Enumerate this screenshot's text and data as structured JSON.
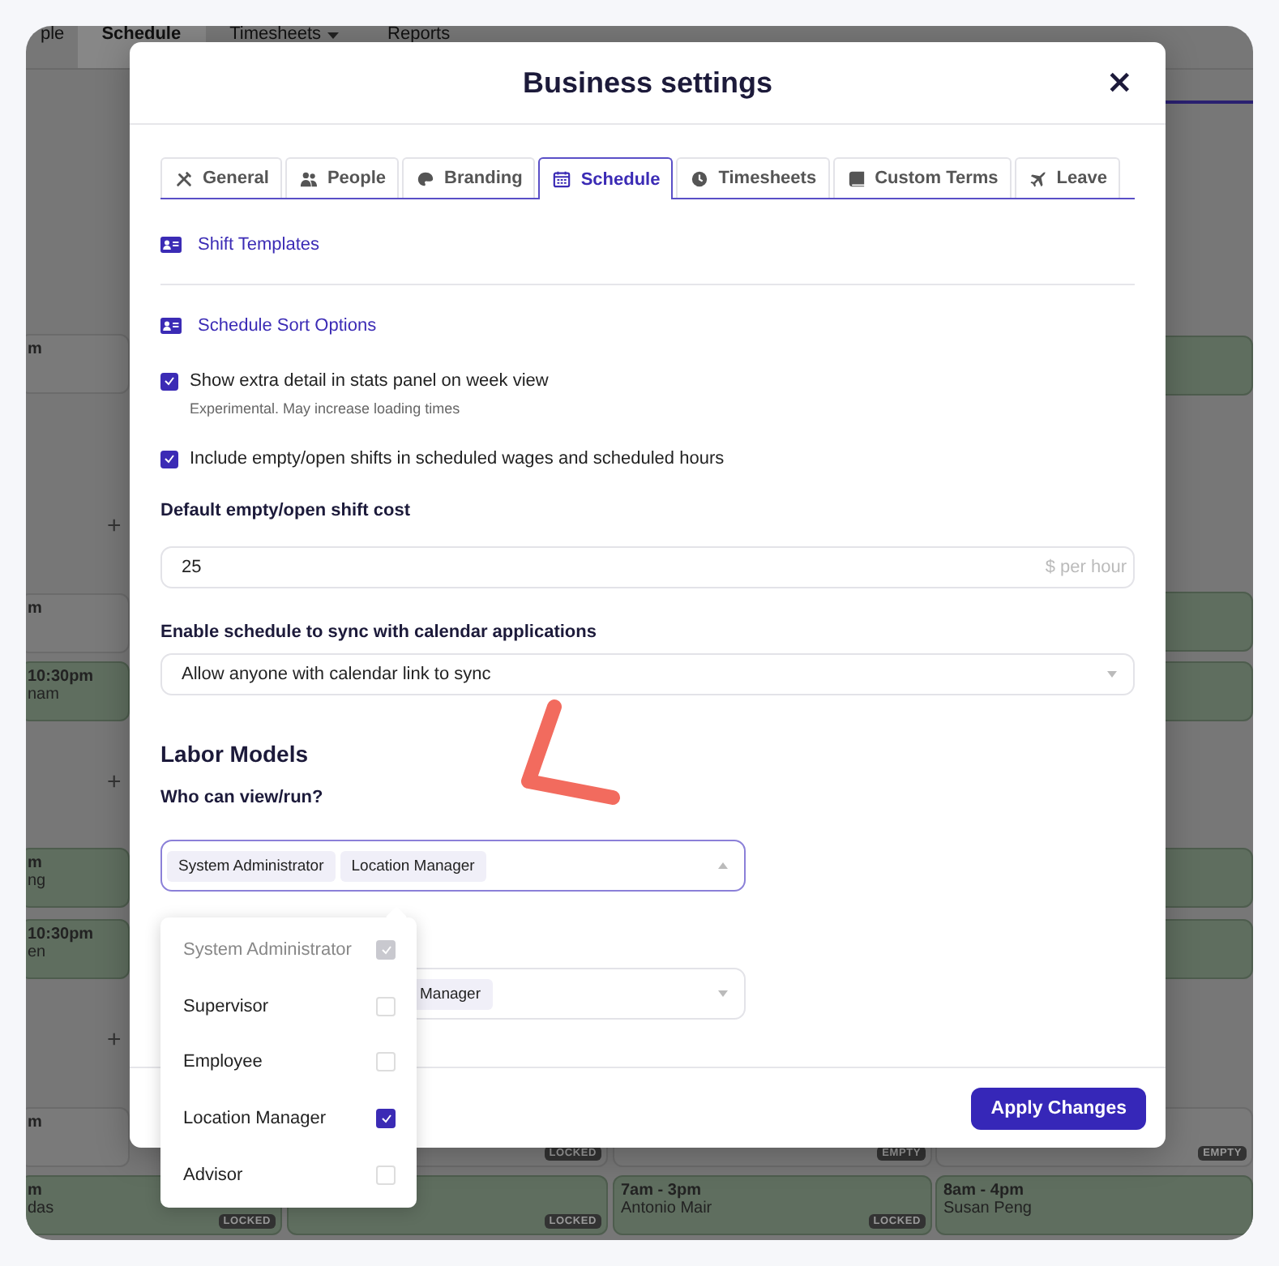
{
  "background": {
    "nav": [
      {
        "label": "ple",
        "selected": false,
        "dropdown": false
      },
      {
        "label": "Schedule",
        "selected": true,
        "dropdown": false
      },
      {
        "label": "Timesheets",
        "selected": false,
        "dropdown": true
      },
      {
        "label": "Reports",
        "selected": false,
        "dropdown": false
      }
    ],
    "shifts": [
      {
        "time": "m",
        "filled": false
      },
      {
        "time": "m",
        "filled": false
      },
      {
        "time": "10:30pm",
        "name": "nam",
        "filled": true
      },
      {
        "time": "m",
        "name": "ng",
        "filled": true
      },
      {
        "time": "10:30pm",
        "name": "en",
        "filled": true
      },
      {
        "time": "m",
        "filled": false
      },
      {
        "time": "m",
        "name": "das",
        "badge": "LOCKED",
        "filled": true
      },
      {
        "badge": "LOCKED",
        "filled": false
      },
      {
        "badge": "LOCKED",
        "filled": true
      },
      {
        "badge": "EMPTY",
        "filled": false
      },
      {
        "time": "7am - 3pm",
        "name": "Antonio Mair",
        "badge": "LOCKED",
        "filled": true
      },
      {
        "badge": "EMPTY",
        "filled": false
      },
      {
        "time": "8am - 4pm",
        "name": "Susan Peng",
        "filled": true
      },
      {
        "filled": true
      },
      {
        "filled": true
      },
      {
        "filled": true
      },
      {
        "filled": true
      },
      {
        "filled": true
      }
    ],
    "add_buttons": [
      "+",
      "+",
      "+"
    ]
  },
  "dialog": {
    "title": "Business settings",
    "close": "×",
    "tabs": [
      {
        "label": "General",
        "selected": false
      },
      {
        "label": "People",
        "selected": false
      },
      {
        "label": "Branding",
        "selected": false
      },
      {
        "label": "Schedule",
        "selected": true
      },
      {
        "label": "Timesheets",
        "selected": false
      },
      {
        "label": "Custom Terms",
        "selected": false
      },
      {
        "label": "Leave",
        "selected": false
      }
    ],
    "links": [
      "Shift Templates",
      "Schedule Sort Options"
    ],
    "options": [
      {
        "label": "Show extra detail in stats panel on week view",
        "hint": "Experimental. May increase loading times",
        "checked": true
      },
      {
        "label": "Include empty/open shifts in scheduled wages and scheduled hours",
        "checked": true
      }
    ],
    "cost": {
      "label": "Default empty/open shift cost",
      "value": "25",
      "suffix": "$ per hour"
    },
    "calendar_sync": {
      "label": "Enable schedule to sync with calendar applications",
      "value": "Allow anyone with calendar link to sync"
    },
    "labor_models": {
      "heading": "Labor Models",
      "view_label": "Who can view/run?",
      "view_select": {
        "tags": [
          "System Administrator",
          "Location Manager"
        ],
        "open": true
      },
      "run_select": {
        "tags": [
          "Manager"
        ],
        "open": false
      },
      "menu": [
        {
          "label": "System Administrator",
          "checked": true,
          "disabled": true
        },
        {
          "label": "Supervisor",
          "checked": false,
          "disabled": false
        },
        {
          "label": "Employee",
          "checked": false,
          "disabled": false
        },
        {
          "label": "Location Manager",
          "checked": true,
          "disabled": false
        },
        {
          "label": "Advisor",
          "checked": false,
          "disabled": false
        }
      ]
    },
    "apply_button": "Apply Changes"
  }
}
